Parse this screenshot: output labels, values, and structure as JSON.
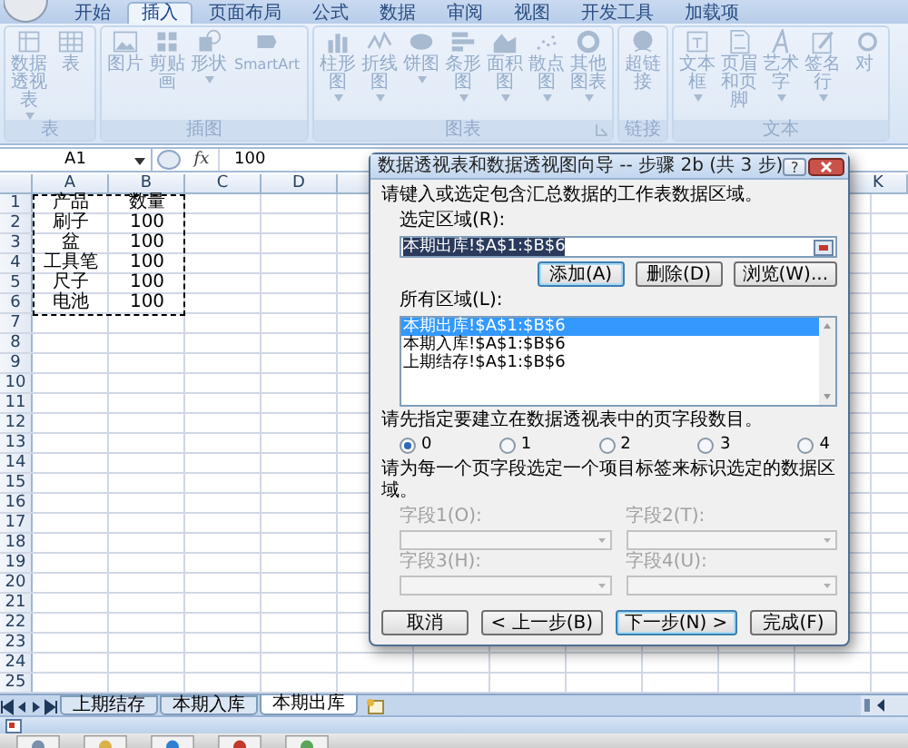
{
  "ribbon_tabs": [
    {
      "label": "开始",
      "selected": false
    },
    {
      "label": "插入",
      "selected": true
    },
    {
      "label": "页面布局",
      "selected": false
    },
    {
      "label": "公式",
      "selected": false
    },
    {
      "label": "数据",
      "selected": false
    },
    {
      "label": "审阅",
      "selected": false
    },
    {
      "label": "视图",
      "selected": false
    },
    {
      "label": "开发工具",
      "selected": false
    },
    {
      "label": "加载项",
      "selected": false
    }
  ],
  "ribbon": {
    "disabled": true,
    "groups": [
      {
        "label": "表",
        "launcher": false,
        "items": [
          {
            "label": "数据透视表",
            "has_menu": true
          },
          {
            "label": "表",
            "has_menu": false
          }
        ]
      },
      {
        "label": "插图",
        "launcher": false,
        "items": [
          {
            "label": "图片",
            "has_menu": false
          },
          {
            "label": "剪贴画",
            "has_menu": false
          },
          {
            "label": "形状",
            "has_menu": true
          },
          {
            "label": "SmartArt",
            "has_menu": false
          }
        ]
      },
      {
        "label": "图表",
        "launcher": true,
        "items": [
          {
            "label": "柱形图",
            "has_menu": true
          },
          {
            "label": "折线图",
            "has_menu": true
          },
          {
            "label": "饼图",
            "has_menu": true
          },
          {
            "label": "条形图",
            "has_menu": true
          },
          {
            "label": "面积图",
            "has_menu": true
          },
          {
            "label": "散点图",
            "has_menu": true
          },
          {
            "label": "其他图表",
            "has_menu": true
          }
        ]
      },
      {
        "label": "链接",
        "launcher": false,
        "items": [
          {
            "label": "超链接",
            "has_menu": false
          }
        ]
      },
      {
        "label": "文本",
        "launcher": false,
        "items": [
          {
            "label": "文本框",
            "has_menu": true
          },
          {
            "label": "页眉和页脚",
            "has_menu": false
          },
          {
            "label": "艺术字",
            "has_menu": true
          },
          {
            "label": "签名行",
            "has_menu": true
          },
          {
            "label": "对",
            "has_menu": false
          }
        ]
      }
    ]
  },
  "formula_bar": {
    "name_box": "A1",
    "function_label": "fx",
    "value": "100"
  },
  "sheet": {
    "columns": [
      "A",
      "B",
      "C",
      "D"
    ],
    "far_columns": [
      "K"
    ],
    "copy_marquee": true,
    "rows": [
      {
        "number": "1",
        "cells": [
          "产品",
          "数量"
        ]
      },
      {
        "number": "2",
        "cells": [
          "刷子",
          "100"
        ]
      },
      {
        "number": "3",
        "cells": [
          "盆",
          "100"
        ]
      },
      {
        "number": "4",
        "cells": [
          "工具笔",
          "100"
        ]
      },
      {
        "number": "5",
        "cells": [
          "尺子",
          "100"
        ]
      },
      {
        "number": "6",
        "cells": [
          "电池",
          "100"
        ]
      },
      {
        "number": "7"
      },
      {
        "number": "8"
      },
      {
        "number": "9"
      },
      {
        "number": "10"
      },
      {
        "number": "11"
      },
      {
        "number": "12"
      },
      {
        "number": "13"
      },
      {
        "number": "14"
      },
      {
        "number": "15"
      },
      {
        "number": "16"
      },
      {
        "number": "17"
      },
      {
        "number": "18"
      },
      {
        "number": "19"
      },
      {
        "number": "20"
      },
      {
        "number": "21"
      },
      {
        "number": "22"
      },
      {
        "number": "23"
      },
      {
        "number": "24"
      },
      {
        "number": "25"
      }
    ]
  },
  "sheet_tabs": [
    {
      "label": "上期结存",
      "selected": false
    },
    {
      "label": "本期入库",
      "selected": false
    },
    {
      "label": "本期出库",
      "selected": true
    }
  ],
  "dialog": {
    "title": "数据透视表和数据透视图向导 -- 步骤 2b (共 3 步)",
    "help_label": "?",
    "prompt": "请键入或选定包含汇总数据的工作表数据区域。",
    "range_label": "选定区域(R):",
    "range_value": "本期出库!$A$1:$B$6",
    "range_value_selected": true,
    "range_buttons": [
      {
        "label": "添加(A)",
        "default": true
      },
      {
        "label": "删除(D)",
        "default": false
      },
      {
        "label": "浏览(W)...",
        "default": false
      }
    ],
    "all_ranges_label": "所有区域(L):",
    "all_ranges": [
      {
        "text": "本期出库!$A$1:$B$6",
        "selected": true
      },
      {
        "text": "本期入库!$A$1:$B$6",
        "selected": false
      },
      {
        "text": "上期结存!$A$1:$B$6",
        "selected": false
      }
    ],
    "page_fields_prompt": "请先指定要建立在数据透视表中的页字段数目。",
    "page_field_counts": [
      {
        "label": "0",
        "selected": true
      },
      {
        "label": "1",
        "selected": false
      },
      {
        "label": "2",
        "selected": false
      },
      {
        "label": "3",
        "selected": false
      },
      {
        "label": "4",
        "selected": false
      }
    ],
    "item_labels_prompt": "请为每一个页字段选定一个项目标签来标识选定的数据区域。",
    "fields": [
      {
        "label": "字段1(O):",
        "disabled": true
      },
      {
        "label": "字段2(T):",
        "disabled": true
      },
      {
        "label": "字段3(H):",
        "disabled": true
      },
      {
        "label": "字段4(U):",
        "disabled": true
      }
    ],
    "footer_buttons": [
      {
        "label": "取消",
        "default": false
      },
      {
        "label": "< 上一步(B)",
        "default": false
      },
      {
        "label": "下一步(N) >",
        "default": true
      },
      {
        "label": "完成(F)",
        "default": false
      }
    ]
  }
}
